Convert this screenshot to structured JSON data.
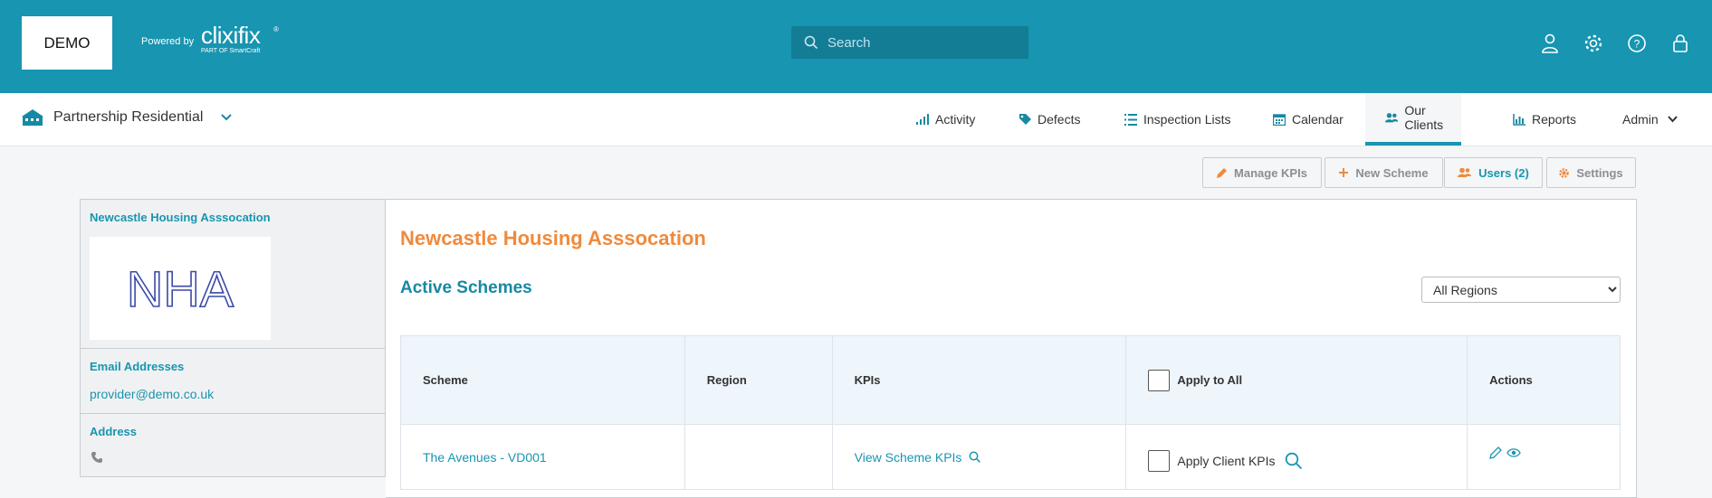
{
  "header": {
    "logo_text": "DEMO",
    "powered_by": "Powered by",
    "brand_name": "clixifix",
    "brand_sub": "PART OF SmartCraft",
    "brand_reg": "®",
    "search_placeholder": "Search",
    "icons": [
      "user-icon",
      "gear-icon",
      "help-icon",
      "lock-icon"
    ]
  },
  "nav": {
    "org_name": "Partnership Residential",
    "items": [
      {
        "label": "Activity",
        "icon": "activity-icon"
      },
      {
        "label": "Defects",
        "icon": "tag-icon"
      },
      {
        "label": "Inspection Lists",
        "icon": "list-icon"
      },
      {
        "label": "Calendar",
        "icon": "calendar-icon"
      },
      {
        "label": "Our Clients",
        "icon": "users-icon",
        "active": true
      },
      {
        "label": "Reports",
        "icon": "chart-icon"
      },
      {
        "label": "Admin",
        "icon": "chevron-down-icon"
      }
    ]
  },
  "actions": {
    "manage_kpis": "Manage KPIs",
    "new_scheme": "New Scheme",
    "users": "Users (2)",
    "settings": "Settings"
  },
  "client": {
    "name": "Newcastle Housing Asssocation",
    "logo_text": "NHA",
    "email_title": "Email Addresses",
    "email": "provider@demo.co.uk",
    "address_title": "Address"
  },
  "main": {
    "title": "Newcastle Housing Asssocation",
    "schemes_title": "Active Schemes",
    "region_filter": "All Regions"
  },
  "table": {
    "headers": {
      "scheme": "Scheme",
      "region": "Region",
      "kpis": "KPIs",
      "apply_all": "Apply to All",
      "actions": "Actions"
    },
    "rows": [
      {
        "scheme": "The Avenues - VD001",
        "region": "",
        "kpis": "View Scheme KPIs",
        "apply": "Apply Client KPIs"
      }
    ]
  },
  "colors": {
    "primary": "#1795b1",
    "accent": "#f08a3c"
  }
}
